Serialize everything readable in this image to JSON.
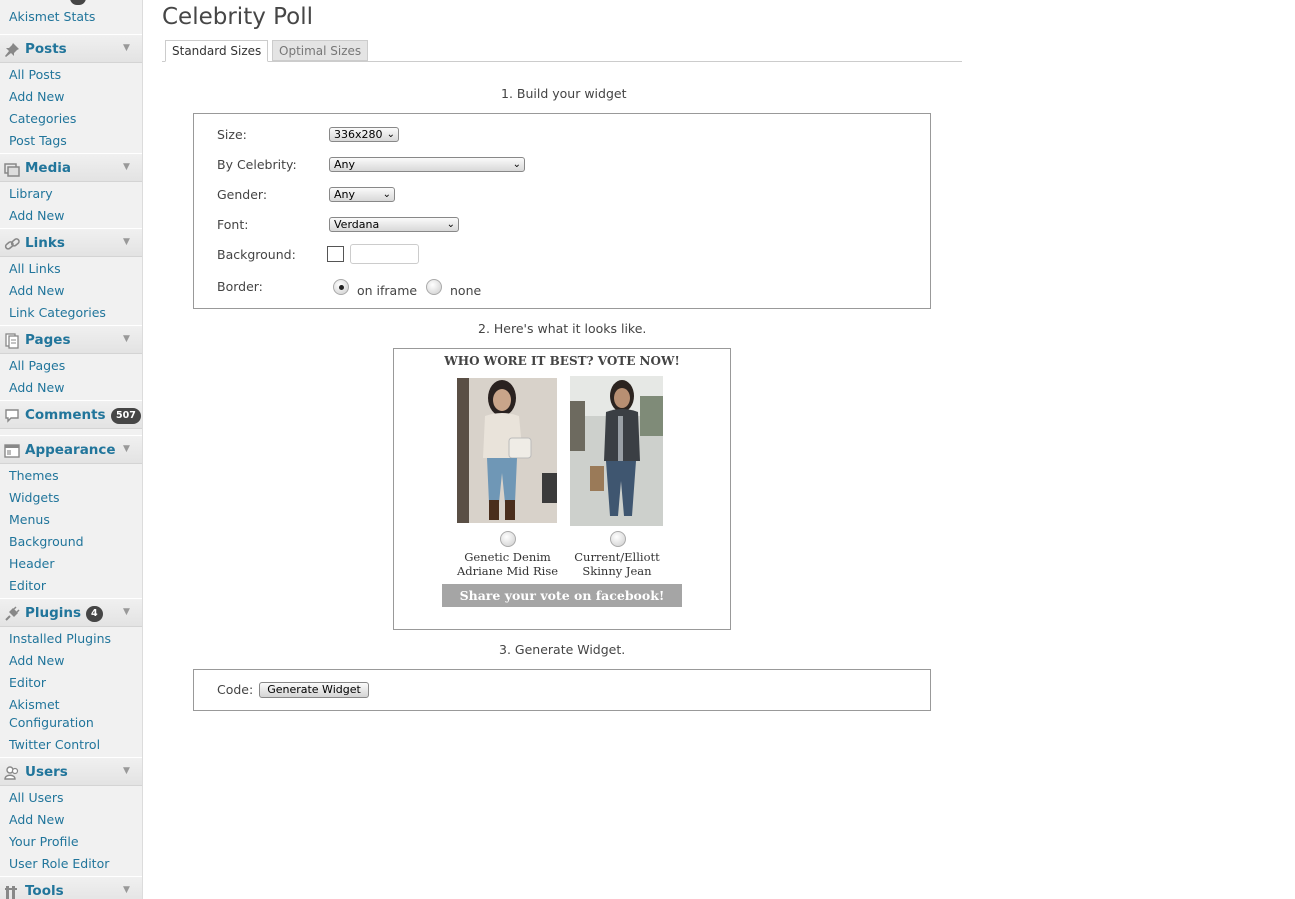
{
  "sidebar": {
    "akismet_stats": "Akismet Stats",
    "posts": {
      "label": "Posts",
      "items": [
        "All Posts",
        "Add New",
        "Categories",
        "Post Tags"
      ]
    },
    "media": {
      "label": "Media",
      "items": [
        "Library",
        "Add New"
      ]
    },
    "links": {
      "label": "Links",
      "items": [
        "All Links",
        "Add New",
        "Link Categories"
      ]
    },
    "pages": {
      "label": "Pages",
      "items": [
        "All Pages",
        "Add New"
      ]
    },
    "comments": {
      "label": "Comments",
      "badge": "507"
    },
    "appearance": {
      "label": "Appearance",
      "items": [
        "Themes",
        "Widgets",
        "Menus",
        "Background",
        "Header",
        "Editor"
      ]
    },
    "plugins": {
      "label": "Plugins",
      "badge": "4",
      "items": [
        "Installed Plugins",
        "Add New",
        "Editor",
        "Akismet",
        "Configuration",
        "Twitter Control"
      ]
    },
    "users": {
      "label": "Users",
      "items": [
        "All Users",
        "Add New",
        "Your Profile",
        "User Role Editor"
      ]
    },
    "tools": {
      "label": "Tools"
    },
    "accent_color": "#21759b",
    "collapse_arrow": "▼"
  },
  "main": {
    "title": "Celebrity Poll",
    "tabs": [
      "Standard Sizes",
      "Optimal Sizes"
    ],
    "step1": "1. Build your widget",
    "form": {
      "size_label": "Size:",
      "size_value": "336x280",
      "celebrity_label": "By Celebrity:",
      "celebrity_value": "Any",
      "gender_label": "Gender:",
      "gender_value": "Any",
      "font_label": "Font:",
      "font_value": "Verdana",
      "background_label": "Background:",
      "background_value": "",
      "border_label": "Border:",
      "border_options": [
        "on iframe",
        "none"
      ],
      "border_selected": "on iframe"
    },
    "step2": "2. Here's what it looks like.",
    "preview": {
      "title": "WHO WORE IT BEST? VOTE NOW!",
      "choices": [
        {
          "line1": "Genetic Denim",
          "line2": "Adriane Mid Rise"
        },
        {
          "line1": "Current/Elliott",
          "line2": "Skinny Jean"
        }
      ],
      "share_label": "Share your vote on facebook!"
    },
    "step3": "3. Generate Widget.",
    "code_label": "Code:",
    "generate_label": "Generate Widget"
  }
}
